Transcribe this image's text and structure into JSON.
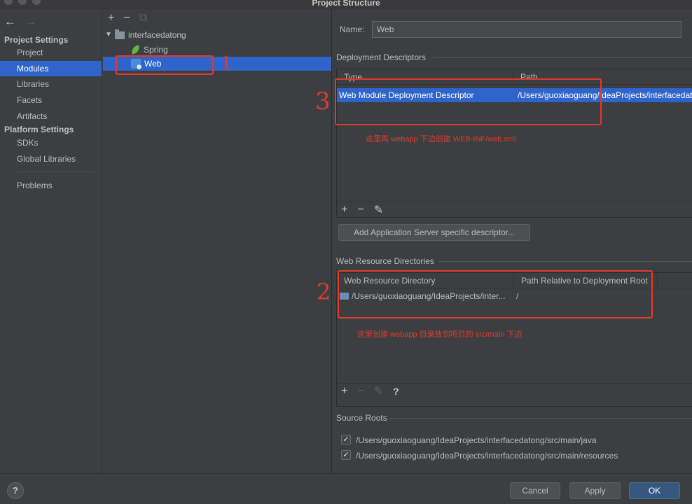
{
  "window": {
    "title": "Project Structure"
  },
  "nav": {
    "back_icon": "arrow-left-icon",
    "forward_icon": "arrow-right-icon",
    "project_settings_header": "Project Settings",
    "project_items": [
      "Project",
      "Modules",
      "Libraries",
      "Facets",
      "Artifacts"
    ],
    "platform_settings_header": "Platform Settings",
    "platform_items": [
      "SDKs",
      "Global Libraries"
    ],
    "problems": "Problems",
    "selected": "Modules"
  },
  "tree": {
    "root": "interfacedatong",
    "children": [
      "Spring",
      "Web"
    ],
    "selected": "Web"
  },
  "main": {
    "name_label": "Name:",
    "name_value": "Web",
    "deploy_section": "Deployment Descriptors",
    "deploy_table": {
      "headers": [
        "Type",
        "Path"
      ],
      "rows": [
        [
          "Web Module Deployment Descriptor",
          "/Users/guoxiaoguang/IdeaProjects/interfacedatong"
        ]
      ]
    },
    "add_server_button": "Add Application Server specific descriptor...",
    "web_res_section": "Web Resource Directories",
    "web_res_table": {
      "headers": [
        "Web Resource Directory",
        "Path Relative to Deployment Root"
      ],
      "rows": [
        [
          "/Users/guoxiaoguang/IdeaProjects/inter...",
          "/"
        ]
      ]
    },
    "help_glyph": "?",
    "source_roots_section": "Source Roots",
    "source_roots": [
      {
        "checked": true,
        "path": "/Users/guoxiaoguang/IdeaProjects/interfacedatong/src/main/java"
      },
      {
        "checked": true,
        "path": "/Users/guoxiaoguang/IdeaProjects/interfacedatong/src/main/resources"
      }
    ]
  },
  "footer": {
    "help": "?",
    "cancel": "Cancel",
    "apply": "Apply",
    "ok": "OK"
  },
  "annotations": {
    "mark1": "1",
    "mark2": "2",
    "mark3": "3",
    "note_webxml": "这里再 webapp 下边创建 WEB-INF/web.xml",
    "note_webapp": "这里创建 webapp 目录放到项目的 src/main 下边",
    "color": "#e03a2e"
  },
  "colors": {
    "selection": "#2f65ca",
    "background": "#3c3f41",
    "primary_button": "#365880"
  }
}
